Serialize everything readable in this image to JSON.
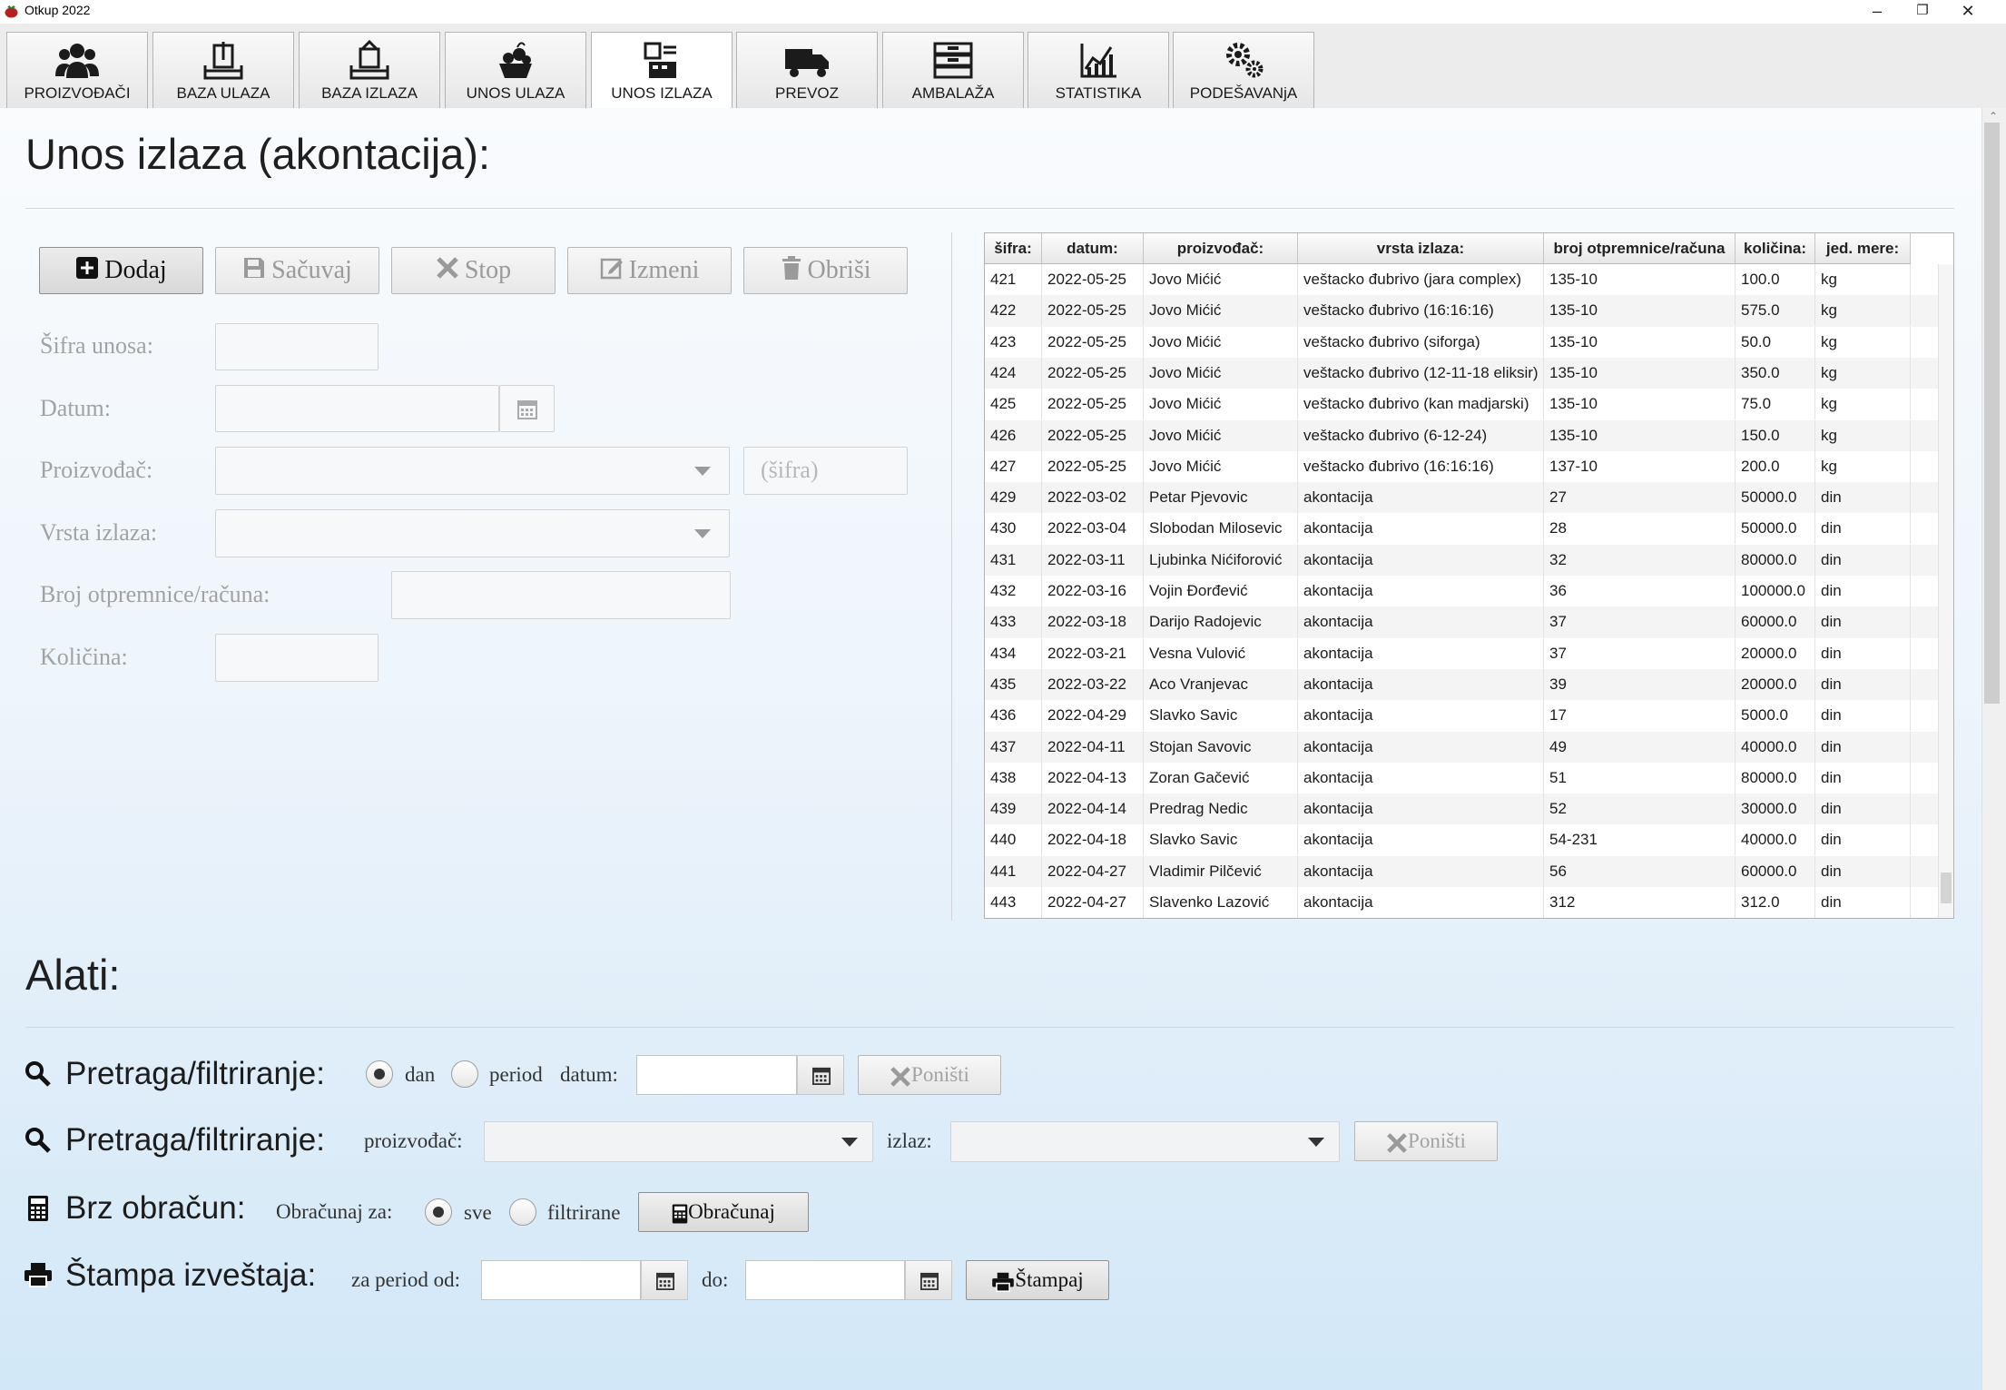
{
  "window": {
    "title": "Otkup 2022",
    "minimize": "–",
    "restore": "❐",
    "close": "✕"
  },
  "tabs": [
    {
      "label": "PROIZVOĐAČI",
      "icon": "people-icon"
    },
    {
      "label": "BAZA ULAZA",
      "icon": "inbox-in-icon"
    },
    {
      "label": "BAZA IZLAZA",
      "icon": "inbox-out-icon"
    },
    {
      "label": "UNOS ULAZA",
      "icon": "produce-icon"
    },
    {
      "label": "UNOS IZLAZA",
      "icon": "cash-register-icon",
      "selected": true
    },
    {
      "label": "PREVOZ",
      "icon": "truck-icon"
    },
    {
      "label": "AMBALAŽA",
      "icon": "crates-icon"
    },
    {
      "label": "STATISTIKA",
      "icon": "chart-icon"
    },
    {
      "label": "PODEŠAVANjA",
      "icon": "gears-icon"
    }
  ],
  "form": {
    "heading": "Unos izlaza (akontacija):",
    "buttons": {
      "dodaj": "Dodaj",
      "sacuvaj": "Sačuvaj",
      "stop": "Stop",
      "izmeni": "Izmeni",
      "obrisi": "Obriši"
    },
    "labels": {
      "sifra": "Šifra unosa:",
      "datum": "Datum:",
      "proizvodjac": "Proizvođač:",
      "vrsta": "Vrsta izlaza:",
      "broj": "Broj otpremnice/računa:",
      "kolicina": "Količina:"
    },
    "sifra_placeholder": "(šifra)"
  },
  "table": {
    "headers": [
      "šifra:",
      "datum:",
      "proizvođač:",
      "vrsta izlaza:",
      "broj otpremnice/računa",
      "količina:",
      "jed. mere:"
    ],
    "rows": [
      [
        "421",
        "2022-05-25",
        "Jovo Mićić",
        "veštacko đubrivo (jara complex)",
        "135-10",
        "100.0",
        "kg"
      ],
      [
        "422",
        "2022-05-25",
        "Jovo Mićić",
        "veštacko đubrivo (16:16:16)",
        "135-10",
        "575.0",
        "kg"
      ],
      [
        "423",
        "2022-05-25",
        "Jovo Mićić",
        "veštacko đubrivo (siforga)",
        "135-10",
        "50.0",
        "kg"
      ],
      [
        "424",
        "2022-05-25",
        "Jovo Mićić",
        "veštacko đubrivo (12-11-18 eliksir)",
        "135-10",
        "350.0",
        "kg"
      ],
      [
        "425",
        "2022-05-25",
        "Jovo Mićić",
        "veštacko đubrivo (kan madjarski)",
        "135-10",
        "75.0",
        "kg"
      ],
      [
        "426",
        "2022-05-25",
        "Jovo Mićić",
        "veštacko đubrivo (6-12-24)",
        "135-10",
        "150.0",
        "kg"
      ],
      [
        "427",
        "2022-05-25",
        "Jovo Mićić",
        "veštacko đubrivo (16:16:16)",
        "137-10",
        "200.0",
        "kg"
      ],
      [
        "429",
        "2022-03-02",
        "Petar Pjevovic",
        "akontacija",
        "27",
        "50000.0",
        "din"
      ],
      [
        "430",
        "2022-03-04",
        "Slobodan  Milosevic",
        "akontacija",
        "28",
        "50000.0",
        "din"
      ],
      [
        "431",
        "2022-03-11",
        "Ljubinka Nićiforović",
        "akontacija",
        "32",
        "80000.0",
        "din"
      ],
      [
        "432",
        "2022-03-16",
        "Vojin Đorđević",
        "akontacija",
        "36",
        "100000.0",
        "din"
      ],
      [
        "433",
        "2022-03-18",
        "Darijo Radojevic",
        "akontacija",
        "37",
        "60000.0",
        "din"
      ],
      [
        "434",
        "2022-03-21",
        "Vesna Vulović",
        "akontacija",
        "37",
        "20000.0",
        "din"
      ],
      [
        "435",
        "2022-03-22",
        "Aco Vranjevac",
        "akontacija",
        "39",
        "20000.0",
        "din"
      ],
      [
        "436",
        "2022-04-29",
        "Slavko Savic",
        "akontacija",
        "17",
        "5000.0",
        "din"
      ],
      [
        "437",
        "2022-04-11",
        "Stojan Savovic",
        "akontacija",
        "49",
        "40000.0",
        "din"
      ],
      [
        "438",
        "2022-04-13",
        "Zoran Gačević",
        "akontacija",
        "51",
        "80000.0",
        "din"
      ],
      [
        "439",
        "2022-04-14",
        "Predrag  Nedic",
        "akontacija",
        "52",
        "30000.0",
        "din"
      ],
      [
        "440",
        "2022-04-18",
        "Slavko Savic",
        "akontacija",
        "54-231",
        "40000.0",
        "din"
      ],
      [
        "441",
        "2022-04-27",
        "Vladimir Pilčević",
        "akontacija",
        "56",
        "60000.0",
        "din"
      ],
      [
        "443",
        "2022-04-27",
        "Slavenko Lazović",
        "akontacija",
        "312",
        "312.0",
        "din"
      ]
    ]
  },
  "tools": {
    "heading": "Alati:",
    "filter1": {
      "title": "Pretraga/filtriranje:",
      "opt_dan": "dan",
      "opt_period": "period",
      "datum_label": "datum:",
      "ponisti": "Poništi"
    },
    "filter2": {
      "title": "Pretraga/filtriranje:",
      "proizvodjac_label": "proizvođač:",
      "izlaz_label": "izlaz:",
      "ponisti": "Poništi"
    },
    "calc": {
      "title": "Brz obračun:",
      "za_label": "Obračunaj za:",
      "opt_sve": "sve",
      "opt_filtrirane": "filtrirane",
      "button": "Obračunaj"
    },
    "print": {
      "title": "Štampa izveštaja:",
      "od_label": "za period od:",
      "do_label": "do:",
      "button": "Štampaj"
    }
  }
}
